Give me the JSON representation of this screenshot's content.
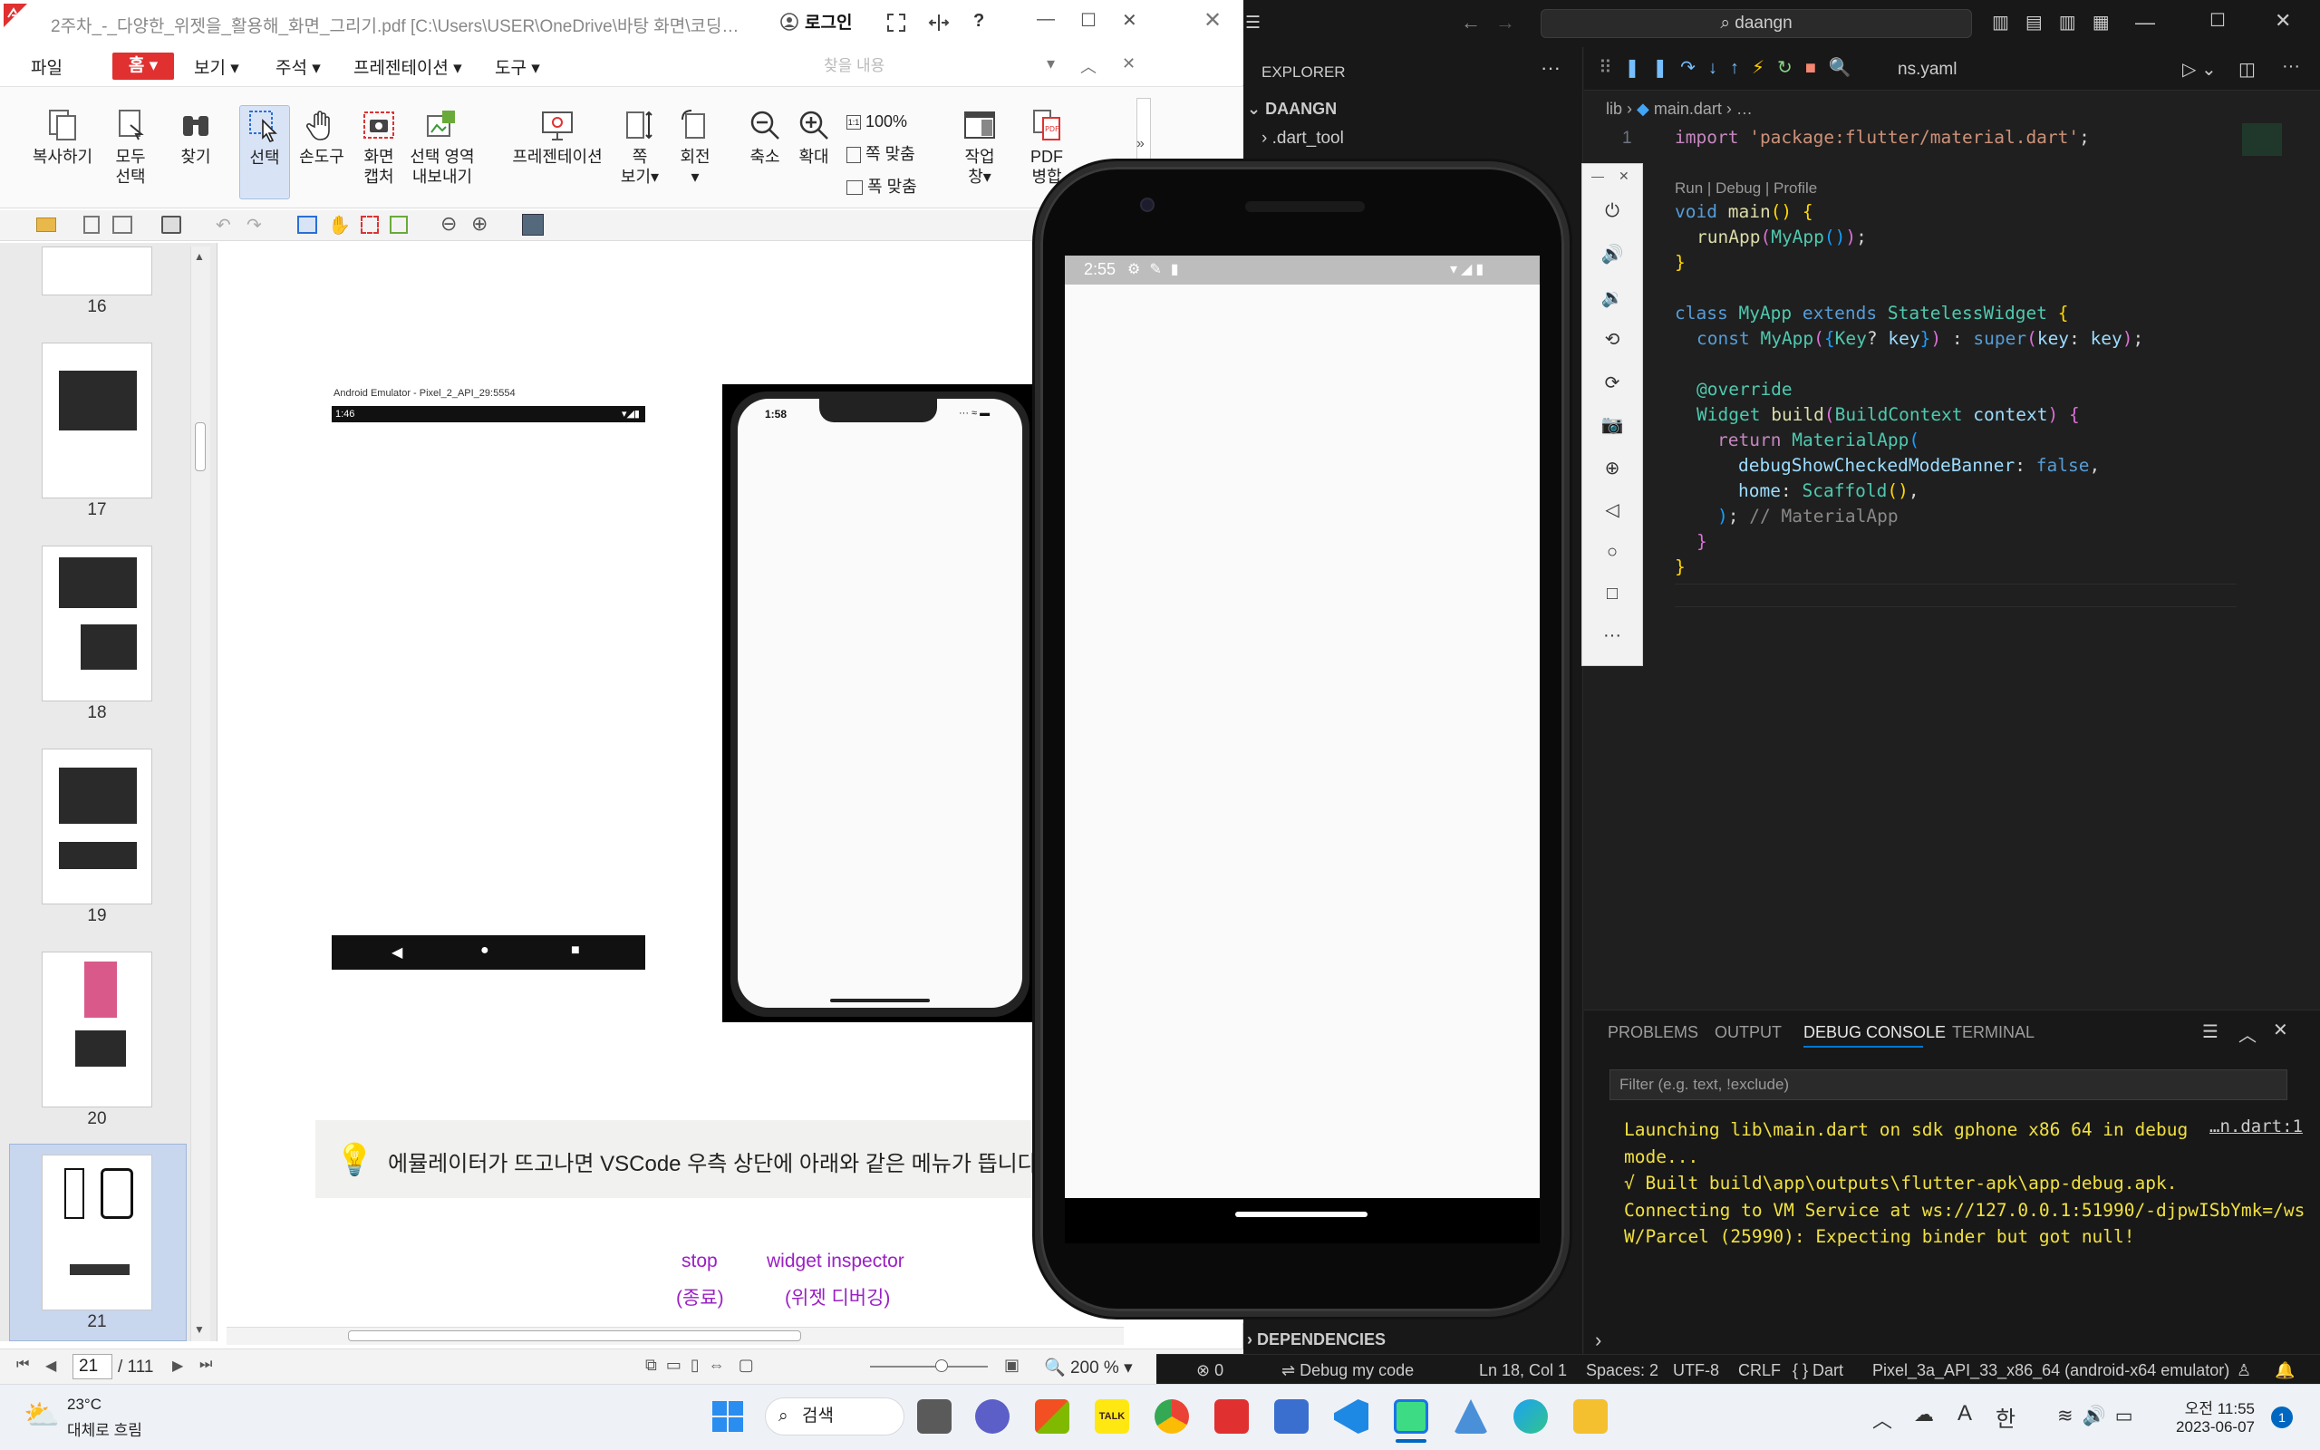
{
  "pdf": {
    "title": "2주차_-_다양한_위젯을_활용해_화면_그리기.pdf [C:\\Users\\USER\\OneDrive\\바탕 화면\\코딩…",
    "login": "로그인",
    "menu": {
      "file": "파일",
      "home": "홈",
      "view": "보기",
      "annotate": "주석",
      "presentation": "프레젠테이션",
      "tools": "도구"
    },
    "search_placeholder": "찾을 내용",
    "ribbon": {
      "copy": "복사하기",
      "select_all_1": "모두",
      "select_all_2": "선택",
      "find": "찾기",
      "select": "선택",
      "hand": "손도구",
      "capture_1": "화면",
      "capture_2": "캡처",
      "export_1": "선택 영역",
      "export_2": "내보내기",
      "presentation": "프레젠테이션",
      "page_view_1": "쪽",
      "page_view_2": "보기",
      "rotate": "회전",
      "zoom_out": "축소",
      "zoom_in": "확대",
      "zoom_100": "100%",
      "fit_page": "쪽 맞춤",
      "fit_width": "폭 맞춤",
      "workspace_1": "작업",
      "workspace_2": "창",
      "pdf_merge_1": "PDF",
      "pdf_merge_2": "병합"
    },
    "thumbnails": [
      "16",
      "17",
      "18",
      "19",
      "20",
      "21"
    ],
    "page": {
      "emulator_caption": "Android Emulator - Pixel_2_API_29:5554",
      "emu_time": "1:46",
      "iphone_time": "1:58",
      "tip": "에뮬레이터가 뜨고나면 VSCode 우측 상단에 아래와 같은 메뉴가 뜹니다.",
      "label_stop": "stop",
      "label_stop_ko": "(종료)",
      "label_inspector": "widget inspector",
      "label_inspector_ko": "(위젯 디버깅)"
    },
    "status": {
      "current_page": "21",
      "total_pages": "/ 111",
      "zoom": "200 %"
    }
  },
  "vscode": {
    "search": "daangn",
    "explorer_title": "EXPLORER",
    "project": "DAANGN",
    "folder": ".dart_tool",
    "tab_partial": "ns.yaml",
    "breadcrumb": {
      "lib": "lib",
      "file": "main.dart",
      "more": "…"
    },
    "codelens": "Run | Debug | Profile",
    "line_number": "1",
    "dependencies": "DEPENDENCIES",
    "panel_tabs": [
      "PROBLEMS",
      "OUTPUT",
      "DEBUG CONSOLE",
      "TERMINAL"
    ],
    "filter_placeholder": "Filter (e.g. text, !exclude)",
    "console": {
      "line1": "Launching lib\\main.dart on sdk gphone x86 64 in debug",
      "line1_link": "…n.dart:1",
      "line2": "mode...",
      "line3": "√  Built build\\app\\outputs\\flutter-apk\\app-debug.apk.",
      "line4": "Connecting to VM Service at ws://127.0.0.1:51990/-djpwISbYmk=/ws",
      "line5": "W/Parcel  (25990): Expecting binder but got null!"
    },
    "statusbar": {
      "errors": "0",
      "debug": "Debug my code",
      "position": "Ln 18, Col 1",
      "spaces": "Spaces: 2",
      "encoding": "UTF-8",
      "eol": "CRLF",
      "language": "{ } Dart",
      "device": "Pixel_3a_API_33_x86_64 (android-x64 emulator)"
    }
  },
  "emulator": {
    "time": "2:55"
  },
  "taskbar": {
    "weather_temp": "23°C",
    "weather_desc": "대체로 흐림",
    "search": "검색",
    "ime_a": "A",
    "ime_lang": "한",
    "time": "오전 11:55",
    "date": "2023-06-07",
    "notif": "1"
  },
  "colors": {
    "pdf_accent": "#e03030",
    "vscode_bg": "#1e1e1e",
    "console_text": "#f0e040",
    "selected_thumb": "#c8d6ee"
  }
}
